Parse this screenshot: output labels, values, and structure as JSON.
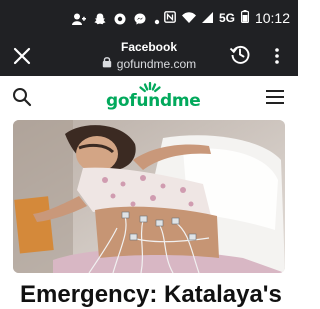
{
  "status_bar": {
    "time": "10:12",
    "network": "5G",
    "left_icons": [
      "person-icon",
      "snapchat-icon",
      "chrome-icon",
      "messenger-icon",
      "dot-icon"
    ],
    "right_icons": [
      "nfc-icon",
      "wifi-icon",
      "signal-icon",
      "battery-icon"
    ]
  },
  "browser": {
    "page_title": "Facebook",
    "url": "gofundme.com"
  },
  "site": {
    "logo_text": "gofundme",
    "brand_color": "#02a95c"
  },
  "campaign": {
    "headline": "Emergency: Katalaya's"
  }
}
